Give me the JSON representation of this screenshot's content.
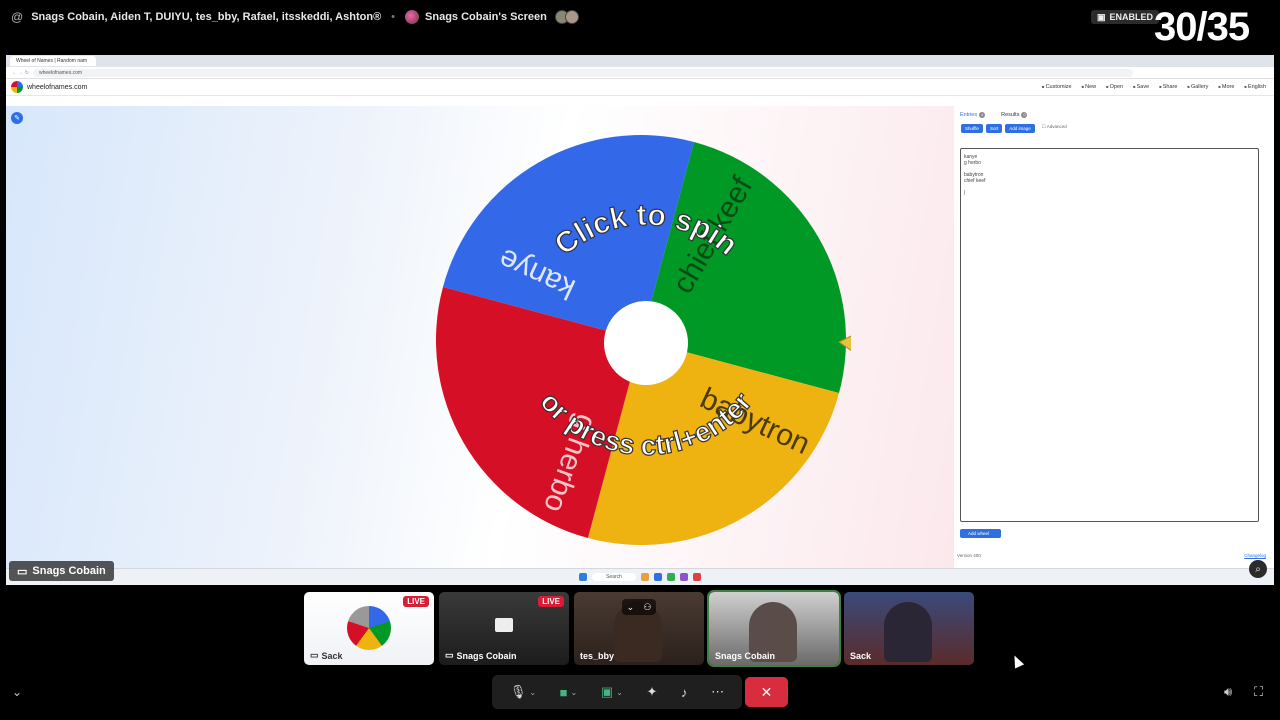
{
  "topbar": {
    "at_symbol": "@",
    "participants": "Snags Cobain, Aiden T, DUIYU, tes_bby, Rafael, itsskeddi, Ashton®",
    "screen_title": "Snags Cobain's Screen",
    "enabled_label": "ENABLED",
    "counter": "30/35"
  },
  "browser": {
    "tab_title": "Wheel of Names | Random nam",
    "url": "wheelofnames.com"
  },
  "site": {
    "name": "wheelofnames.com",
    "actions": [
      "Customize",
      "New",
      "Open",
      "Save",
      "Share",
      "Gallery",
      "More",
      "English"
    ]
  },
  "wheel": {
    "top_text": "Click to spin",
    "bottom_text": "or press ctrl+enter",
    "segments": [
      {
        "label": "kanye",
        "color": "#3369e8"
      },
      {
        "label": "chief keef",
        "color": "#009925"
      },
      {
        "label": "babytron",
        "color": "#eeb211"
      },
      {
        "label": "g herbo",
        "color": "#d50f25"
      }
    ]
  },
  "panel": {
    "tab_entries": "Entries",
    "tab_entries_count": "4",
    "tab_results": "Results",
    "tab_results_count": "0",
    "btn_shuffle": "Shuffle",
    "btn_sort": "Sort",
    "btn_add_image": "Add image",
    "advanced_label": "Advanced",
    "entries": [
      "kanye",
      "g herbo",
      "",
      "babytron",
      "chief keef"
    ],
    "add_wheel": "Add wheel",
    "version": "Version 400",
    "changelog": "Changelog"
  },
  "taskbar": {
    "search": "Search"
  },
  "presenter": {
    "name": "Snags Cobain"
  },
  "tiles": [
    {
      "name": "Sack",
      "live": "LIVE"
    },
    {
      "name": "Snags Cobain",
      "live": "LIVE"
    },
    {
      "name": "tes_bby"
    },
    {
      "name": "Snags Cobain"
    },
    {
      "name": "Sack"
    }
  ],
  "colors": {
    "accent": "#2f6fe4",
    "leave": "#d82d3e",
    "live": "#d81d36"
  }
}
